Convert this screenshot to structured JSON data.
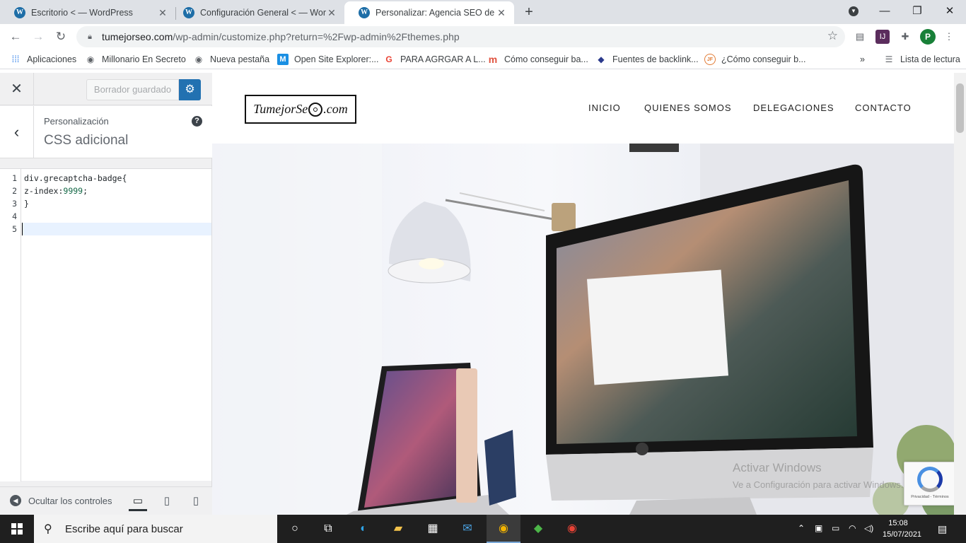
{
  "browser": {
    "tabs": [
      {
        "title": "Escritorio < — WordPress",
        "active": false
      },
      {
        "title": "Configuración General < — Word",
        "active": false
      },
      {
        "title": "Personalizar: Agencia SEO de co",
        "active": true
      }
    ],
    "address": {
      "host": "tumejorseo.com",
      "path": "/wp-admin/customize.php?return=%2Fwp-admin%2Fthemes.php"
    },
    "profile_initial": "P",
    "bookmarks": [
      {
        "label": "Aplicaciones",
        "icon": "apps-grid-icon"
      },
      {
        "label": "Millonario En Secreto",
        "icon": "globe-icon"
      },
      {
        "label": "Nueva pestaña",
        "icon": "globe-icon"
      },
      {
        "label": "Open Site Explorer:...",
        "icon": "moz-icon"
      },
      {
        "label": "PARA AGRGAR A L...",
        "icon": "google-icon"
      },
      {
        "label": "Cómo conseguir ba...",
        "icon": "m-icon"
      },
      {
        "label": "Fuentes de backlink...",
        "icon": "diamond-icon"
      },
      {
        "label": "¿Cómo conseguir b...",
        "icon": "jf-icon"
      }
    ],
    "reading_list": "Lista de lectura"
  },
  "customizer": {
    "saved_button": "Borrador guardado",
    "breadcrumb": "Personalización",
    "section_title": "CSS adicional",
    "help": "?",
    "line_numbers": [
      "1",
      "2",
      "3",
      "4",
      "5"
    ],
    "code": {
      "line1": "div.grecaptcha-badge{",
      "line2_prop": "z-index:",
      "line2_val": "9999",
      "line2_end": ";",
      "line3": "}"
    },
    "hide_controls": "Ocultar los controles",
    "accent_color": "#2271b1"
  },
  "site": {
    "logo_text": "TumejorSe",
    "logo_suffix": ".com",
    "nav": [
      "INICIO",
      "QUIENES SOMOS",
      "DELEGACIONES",
      "CONTACTO"
    ],
    "recaptcha_terms": "Privacidad - Términos"
  },
  "watermark": {
    "line1": "Activar Windows",
    "line2": "Ve a Configuración para activar Windows."
  },
  "taskbar": {
    "search_placeholder": "Escribe aquí para buscar",
    "time": "15:08",
    "date": "15/07/2021"
  }
}
